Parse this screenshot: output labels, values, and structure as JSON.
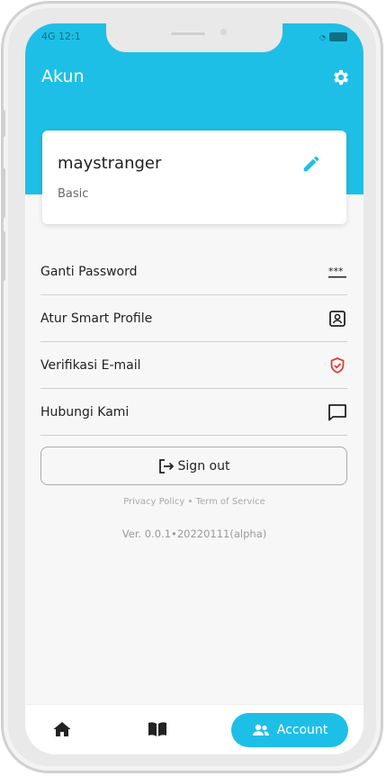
{
  "status": {
    "time": "12:1",
    "signal": "4G"
  },
  "header": {
    "title": "Akun"
  },
  "profile": {
    "username": "maystranger",
    "plan": "Basic"
  },
  "menu": {
    "items": [
      {
        "label": "Ganti Password",
        "icon": "password-icon"
      },
      {
        "label": "Atur Smart Profile",
        "icon": "profile-card-icon"
      },
      {
        "label": "Verifikasi E-mail",
        "icon": "shield-check-icon"
      },
      {
        "label": "Hubungi Kami",
        "icon": "chat-icon"
      }
    ]
  },
  "signout": {
    "label": "Sign out"
  },
  "footer": {
    "links": "Privacy Policy • Term of Service",
    "version": "Ver. 0.0.1•20220111(alpha)"
  },
  "nav": {
    "account_label": "Account"
  },
  "colors": {
    "accent": "#1ebfe6",
    "verify": "#e53935"
  }
}
